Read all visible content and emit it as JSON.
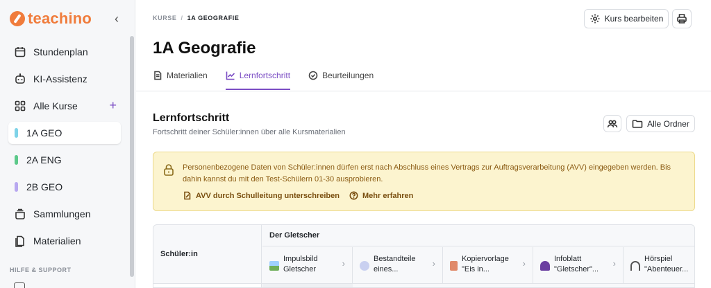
{
  "app": {
    "logo_text": "teachino",
    "accent": "#7b4dc4",
    "brand": "#f07c3c"
  },
  "sidebar": {
    "items": [
      {
        "label": "Stundenplan",
        "icon": "calendar-icon"
      },
      {
        "label": "KI-Assistenz",
        "icon": "robot-icon"
      },
      {
        "label": "Alle Kurse",
        "icon": "grid-icon",
        "action": "+"
      },
      {
        "label": "1A GEO",
        "color": "#7fd3e8",
        "active": true
      },
      {
        "label": "2A ENG",
        "color": "#5cc98a"
      },
      {
        "label": "2B GEO",
        "color": "#b8a8f0"
      },
      {
        "label": "Sammlungen",
        "icon": "stack-icon"
      },
      {
        "label": "Materialien",
        "icon": "files-icon"
      }
    ],
    "section_help": "HILFE & SUPPORT"
  },
  "header": {
    "breadcrumb_root": "KURSE",
    "breadcrumb_sep": "/",
    "breadcrumb_current": "1A GEOGRAFIE",
    "edit_button": "Kurs bearbeiten",
    "page_title": "1A Geografie"
  },
  "tabs": [
    {
      "label": "Materialien",
      "icon": "document-icon"
    },
    {
      "label": "Lernfortschritt",
      "icon": "chart-line-icon",
      "active": true
    },
    {
      "label": "Beurteilungen",
      "icon": "check-circle-icon"
    }
  ],
  "progress": {
    "title": "Lernfortschritt",
    "subtitle": "Fortschritt deiner Schüler:innen über alle Kursmaterialien",
    "folder_button": "Alle Ordner"
  },
  "notice": {
    "text": "Personenbezogene Daten von Schüler:innen dürfen erst nach Abschluss eines Vertrags zur Auftragsverarbeitung (AVV) eingegeben werden. Bis dahin kannst du mit den Test-Schülern 01-30 ausprobieren.",
    "link_sign": "AVV durch Schulleitung unterschreiben",
    "link_more": "Mehr erfahren"
  },
  "table": {
    "student_header": "Schüler:in",
    "group_header": "Der Gletscher",
    "columns": [
      {
        "label": "Impulsbild Gletscher",
        "icon": "image-icon",
        "color": "#6fae5a"
      },
      {
        "label": "Bestandteile eines...",
        "icon": "speech-bubble-icon",
        "color": "#c9d0f0"
      },
      {
        "label": "Kopiervorlage \"Eis in...",
        "icon": "worksheet-icon",
        "color": "#e08a6a"
      },
      {
        "label": "Infoblatt \"Gletscher\"...",
        "icon": "people-icon",
        "color": "#6b3fa0"
      },
      {
        "label": "Hörspiel \"Abenteuer...",
        "icon": "headphones-icon",
        "color": "#555"
      }
    ]
  }
}
